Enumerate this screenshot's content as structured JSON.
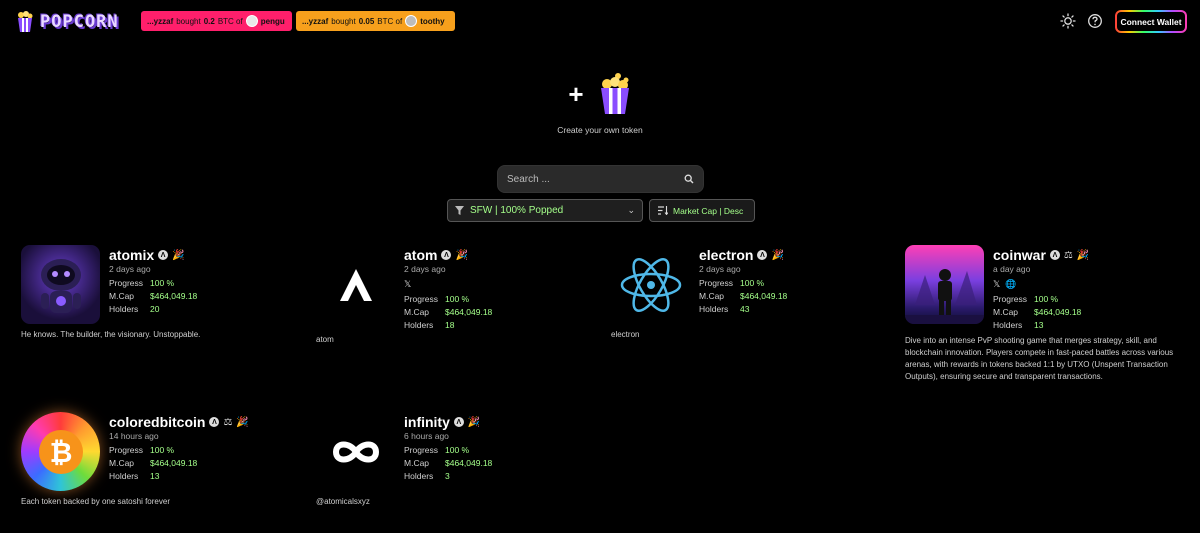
{
  "header": {
    "logo_text": "POPCORN",
    "tickers": [
      {
        "user": "...yzzaf",
        "action": "bought",
        "amount": "0.2",
        "unit": "BTC of",
        "token": "pengu"
      },
      {
        "user": "...yzzaf",
        "action": "bought",
        "amount": "0.05",
        "unit": "BTC of",
        "token": "toothy"
      }
    ],
    "connect_label": "Connect Wallet"
  },
  "create": {
    "label": "Create your own token",
    "plus": "+"
  },
  "search": {
    "placeholder": "Search ..."
  },
  "filter": {
    "label": "SFW | 100% Popped"
  },
  "sort": {
    "label": "Market Cap | Desc"
  },
  "stat_labels": {
    "progress": "Progress",
    "mcap": "M.Cap",
    "holders": "Holders"
  },
  "tokens": [
    {
      "name": "atomix",
      "age": "2 days ago",
      "progress": "100 %",
      "mcap": "$464,049.18",
      "holders": "20",
      "description": "He knows. The builder, the visionary. Unstoppable."
    },
    {
      "name": "atom",
      "age": "2 days ago",
      "progress": "100 %",
      "mcap": "$464,049.18",
      "holders": "18",
      "description": "atom"
    },
    {
      "name": "electron",
      "age": "2 days ago",
      "progress": "100 %",
      "mcap": "$464,049.18",
      "holders": "43",
      "description": "electron"
    },
    {
      "name": "coinwar",
      "age": "a day ago",
      "progress": "100 %",
      "mcap": "$464,049.18",
      "holders": "13",
      "description": "Dive into an intense PvP shooting game that merges strategy, skill, and blockchain innovation. Players compete in fast-paced battles across various arenas, with rewards in tokens backed 1:1 by UTXO (Unspent Transaction Outputs), ensuring secure and transparent transactions."
    },
    {
      "name": "coloredbitcoin",
      "age": "14 hours ago",
      "progress": "100 %",
      "mcap": "$464,049.18",
      "holders": "13",
      "description": "Each token backed by one satoshi forever"
    },
    {
      "name": "infinity",
      "age": "6 hours ago",
      "progress": "100 %",
      "mcap": "$464,049.18",
      "holders": "3",
      "description": "@atomicalsxyz"
    }
  ],
  "colors": {
    "accent_green": "#a4ff8a",
    "ticker_pink": "#ff1f6b",
    "ticker_orange": "#f7a01c"
  }
}
